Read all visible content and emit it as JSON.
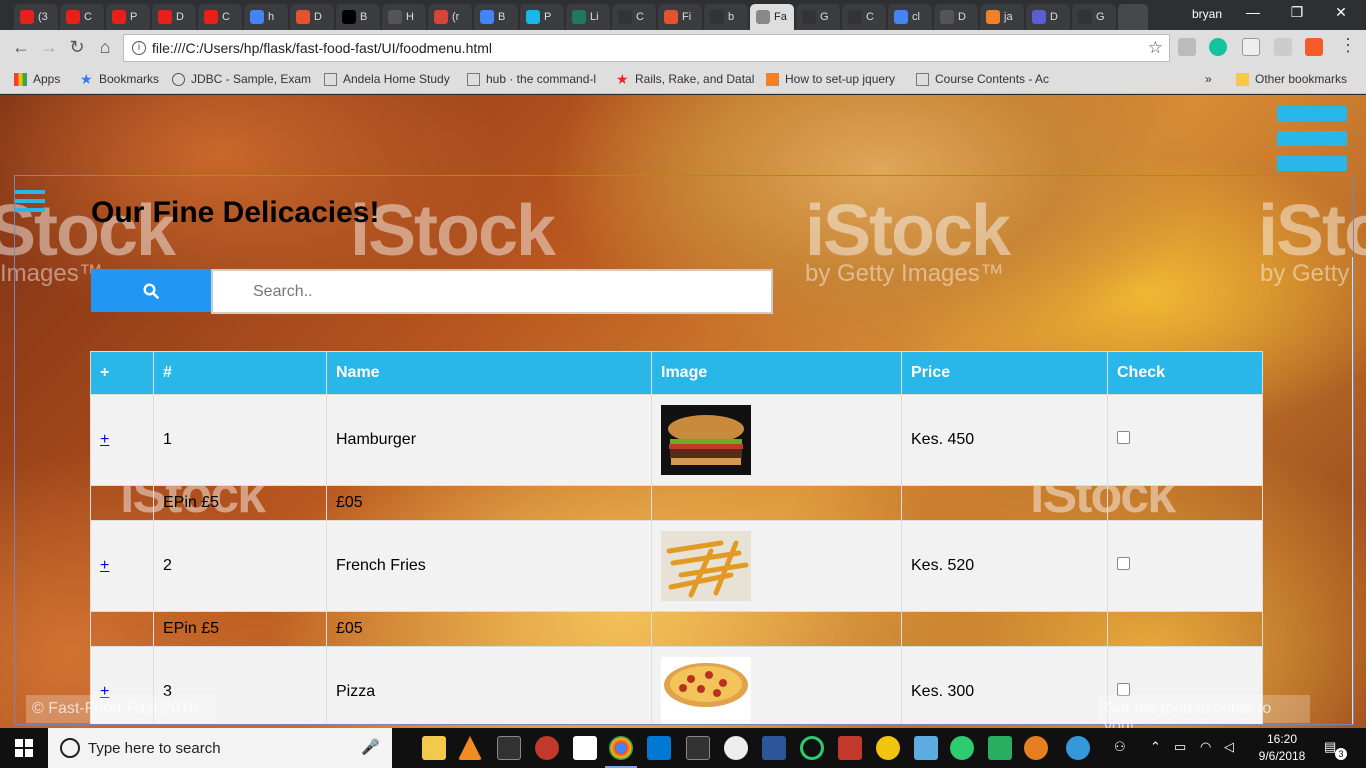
{
  "browser": {
    "tabs": [
      {
        "label": "(3",
        "color": "#e62117"
      },
      {
        "label": "C",
        "color": "#e62117"
      },
      {
        "label": "P",
        "color": "#e62117"
      },
      {
        "label": "D",
        "color": "#e62117"
      },
      {
        "label": "C",
        "color": "#e62117"
      },
      {
        "label": "h",
        "color": "#4285f4"
      },
      {
        "label": "D",
        "color": "#e5532d"
      },
      {
        "label": "B",
        "color": "#000000"
      },
      {
        "label": "H",
        "color": "#555555"
      },
      {
        "label": "(r",
        "color": "#d44638"
      },
      {
        "label": "B",
        "color": "#4285f4"
      },
      {
        "label": "P",
        "color": "#1ab7ea"
      },
      {
        "label": "Li",
        "color": "#1e7a5a"
      },
      {
        "label": "C",
        "color": "#333333"
      },
      {
        "label": "Fi",
        "color": "#e5532d"
      },
      {
        "label": "b",
        "color": "#333333"
      },
      {
        "label": "Fa",
        "color": "#888888",
        "active": true
      },
      {
        "label": "G",
        "color": "#333333"
      },
      {
        "label": "C",
        "color": "#333333"
      },
      {
        "label": "cl",
        "color": "#4285f4"
      },
      {
        "label": "D",
        "color": "#555555"
      },
      {
        "label": "ja",
        "color": "#f48024"
      },
      {
        "label": "D",
        "color": "#5c5cd6"
      },
      {
        "label": "G",
        "color": "#333333"
      }
    ],
    "profile": "bryan",
    "window_controls": {
      "minimize": "—",
      "maximize": "❐",
      "close": "✕"
    },
    "url": "file:///C:/Users/hp/flask/fast-food-fast/UI/foodmenu.html",
    "bookmarks": [
      {
        "label": "Apps"
      },
      {
        "label": "Bookmarks"
      },
      {
        "label": "JDBC - Sample, Exam"
      },
      {
        "label": "Andela Home Study"
      },
      {
        "label": "hub · the command-l"
      },
      {
        "label": "Rails, Rake, and Datal"
      },
      {
        "label": "How to set-up jquery"
      },
      {
        "label": "Course Contents - Ac"
      }
    ],
    "overflow": "»",
    "other_bookmarks": "Other bookmarks"
  },
  "page": {
    "heading": "Our Fine Delicacies!",
    "search_placeholder": "Search..",
    "table": {
      "headers": [
        "+",
        "#",
        "Name",
        "Image",
        "Price",
        "Check"
      ],
      "rows": [
        {
          "plus": "+",
          "num": "1",
          "name": "Hamburger",
          "price": "Kes. 450",
          "detail_num": "EPin £5",
          "detail_name": "£05"
        },
        {
          "plus": "+",
          "num": "2",
          "name": "French Fries",
          "price": "Kes. 520",
          "detail_num": "EPin £5",
          "detail_name": "£05"
        },
        {
          "plus": "+",
          "num": "3",
          "name": "Pizza",
          "price": "Kes. 300"
        }
      ]
    },
    "watermarks": [
      "iStock",
      "iStock",
      "iStock",
      "iStock",
      "iStock",
      "iStock"
    ],
    "watermark_sub": [
      "Images™",
      "by Getty Images™",
      "by Getty"
    ],
    "footer_left": "© Fast-Food-Fast 2018",
    "footer_right": "Get the food to come to you!"
  },
  "taskbar": {
    "search_placeholder": "Type here to search",
    "time": "16:20",
    "date": "9/6/2018",
    "notifications": "3"
  },
  "colors": {
    "accent": "#29b6e8",
    "search_button": "#2196f3"
  }
}
